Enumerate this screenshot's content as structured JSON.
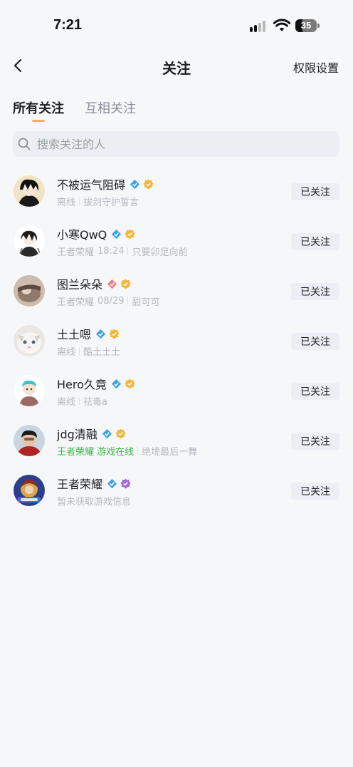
{
  "status_bar": {
    "time": "7:21",
    "battery": "35"
  },
  "nav": {
    "title": "关注",
    "right_label": "权限设置"
  },
  "tabs": [
    {
      "label": "所有关注",
      "active": true
    },
    {
      "label": "互相关注",
      "active": false
    }
  ],
  "search": {
    "placeholder": "搜索关注的人",
    "value": ""
  },
  "follow_button_label": "已关注",
  "users": [
    {
      "name": "不被运气阻碍",
      "status": "离线",
      "game": "",
      "time": "",
      "signature": "拔剑守护誓言",
      "first_badge": "blue-diamond-icon",
      "second_badge": "gold-verified-icon"
    },
    {
      "name": "小寒QwQ",
      "status": "王者荣耀",
      "game": "",
      "time": "18:24",
      "signature": "只要卯足向前",
      "first_badge": "blue-diamond-icon",
      "second_badge": "gold-verified-icon"
    },
    {
      "name": "图兰朵朵",
      "status": "王者荣耀",
      "game": "",
      "time": "08/29",
      "signature": "甜可可",
      "first_badge": "pink-diamond-icon",
      "second_badge": "gold-verified-icon"
    },
    {
      "name": "土土嗯",
      "status": "离线",
      "game": "",
      "time": "",
      "signature": "酷土土土",
      "first_badge": "blue-diamond-icon",
      "second_badge": "gold-verified-icon"
    },
    {
      "name": "Hero久竟",
      "status": "离线",
      "game": "",
      "time": "",
      "signature": "祛毒a",
      "first_badge": "blue-diamond-icon",
      "second_badge": "gold-verified-icon"
    },
    {
      "name": "jdg清融",
      "status": "王者荣耀 游戏在线",
      "game": "online",
      "time": "",
      "signature": "绝境最后一舞",
      "first_badge": "blue-diamond-icon",
      "second_badge": "gold-verified-icon"
    },
    {
      "name": "王者荣耀",
      "status": "暂未获取游戏信息",
      "game": "",
      "time": "",
      "signature": "",
      "first_badge": "blue-diamond-icon",
      "second_badge": "purple-verified-icon"
    }
  ],
  "colors": {
    "accent": "#f5b73b",
    "online": "#3cb846",
    "muted": "#b5b9c1",
    "background": "#f6f7f9"
  }
}
